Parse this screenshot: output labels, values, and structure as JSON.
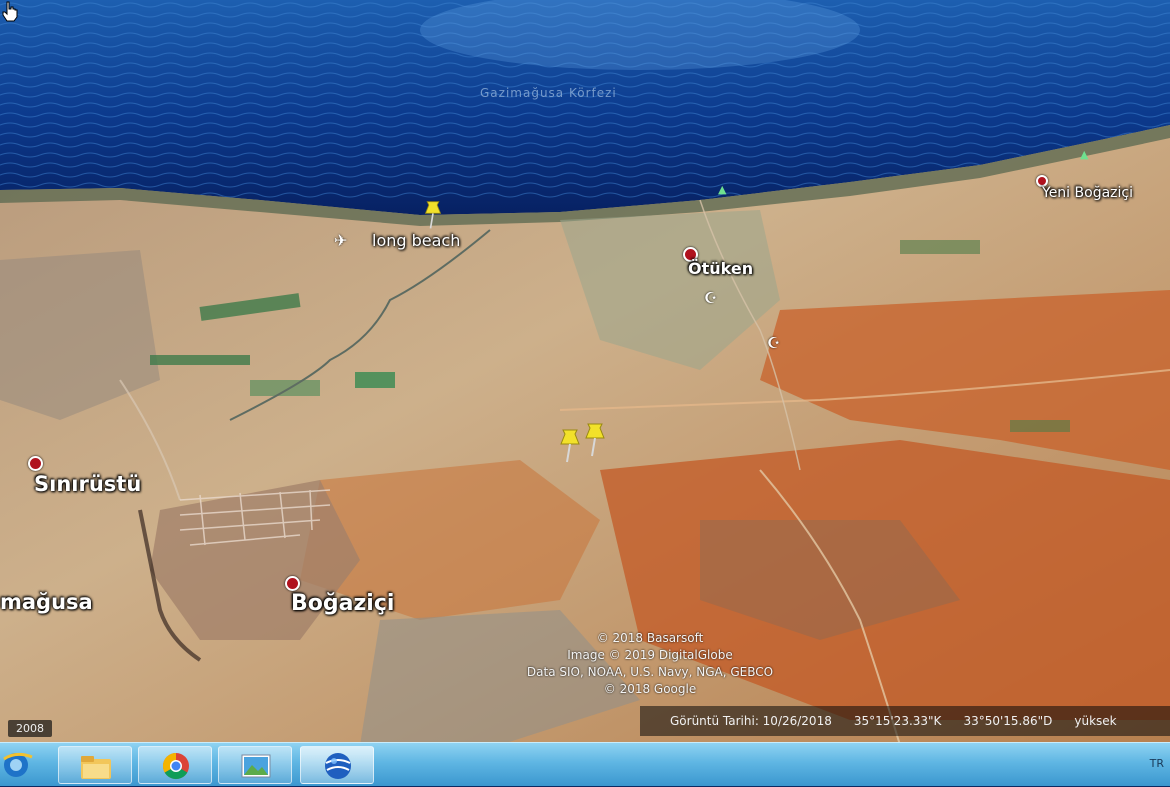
{
  "map": {
    "places": [
      {
        "name": "long beach",
        "type": "landmark"
      },
      {
        "name": "Ötüken",
        "type": "village"
      },
      {
        "name": "Yeni Boğaziçi",
        "type": "village"
      },
      {
        "name": "Sınırüstü",
        "type": "village"
      },
      {
        "name": "mağusa",
        "type": "city"
      },
      {
        "name": "Boğaziçi",
        "type": "village"
      }
    ],
    "sea_label": "Gazimağusa Körfezi",
    "credits": [
      "© 2018 Basarsoft",
      "Image © 2019 DigitalGlobe",
      "Data SIO, NOAA, U.S. Navy, NGA, GEBCO",
      "© 2018 Google"
    ],
    "imagery_year": "2008",
    "status": {
      "date_label": "Görüntü Tarihi: 10/26/2018",
      "latitude": "35°15'23.33\"K",
      "longitude": "33°50'15.86\"D",
      "elevation_label": "yüksek"
    },
    "pins": [
      "yellow-pushpin",
      "yellow-pushpin",
      "yellow-pushpin"
    ],
    "colors": {
      "sea": "#0b3b8a",
      "land": "#c9a37a",
      "fields": "#c8622b",
      "pin": "#f2e12a",
      "place_dot": "#b0121e"
    }
  },
  "taskbar": {
    "icons": [
      "internet-explorer-icon",
      "file-explorer-icon",
      "chrome-icon",
      "photo-viewer-icon",
      "google-earth-icon"
    ],
    "tray": "TR"
  }
}
